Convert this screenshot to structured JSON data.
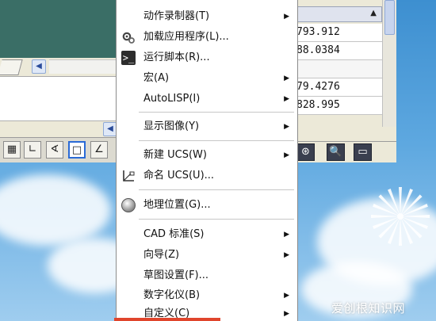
{
  "menu": {
    "items": [
      {
        "label": "动作录制器(T)",
        "icon": "",
        "has_submenu": true
      },
      {
        "label": "加载应用程序(L)...",
        "icon": "gears-icon",
        "has_submenu": false
      },
      {
        "label": "运行脚本(R)...",
        "icon": "script-icon",
        "has_submenu": false
      },
      {
        "label": "宏(A)",
        "icon": "",
        "has_submenu": true
      },
      {
        "label": "AutoLISP(I)",
        "icon": "",
        "has_submenu": true
      },
      {
        "label": "显示图像(Y)",
        "icon": "",
        "has_submenu": true
      },
      {
        "label": "新建 UCS(W)",
        "icon": "",
        "has_submenu": true
      },
      {
        "label": "命名 UCS(U)...",
        "icon": "ucs-icon",
        "has_submenu": false
      },
      {
        "label": "地理位置(G)...",
        "icon": "globe-icon",
        "has_submenu": false
      },
      {
        "label": "CAD 标准(S)",
        "icon": "",
        "has_submenu": true
      },
      {
        "label": "向导(Z)",
        "icon": "",
        "has_submenu": true
      },
      {
        "label": "草图设置(F)...",
        "icon": "",
        "has_submenu": false
      },
      {
        "label": "数字化仪(B)",
        "icon": "",
        "has_submenu": true
      },
      {
        "label": "自定义(C)",
        "icon": "",
        "has_submenu": true
      }
    ],
    "script_icon_glyph": ">_",
    "submenu_arrow": "▶"
  },
  "properties": {
    "values": [
      "793.912",
      "88.0384",
      "",
      "79.4276",
      "828.995"
    ],
    "sort_arrow": "▲"
  },
  "left_window": {
    "scroll_left": "◀",
    "scroll_right": "◀",
    "status_buttons": [
      "▦",
      "∟",
      "∢",
      "□",
      "∠"
    ]
  },
  "right_toolbar": {
    "buttons": [
      "⊛",
      "🔍",
      "▭"
    ]
  },
  "watermark": {
    "text": "爱创根知识网"
  },
  "colors": {
    "menu_bg": "#ffffff",
    "canvas_green": "#3a6e66",
    "desktop_blue": "#5ea8e0",
    "accent_red": "#e0452c"
  }
}
